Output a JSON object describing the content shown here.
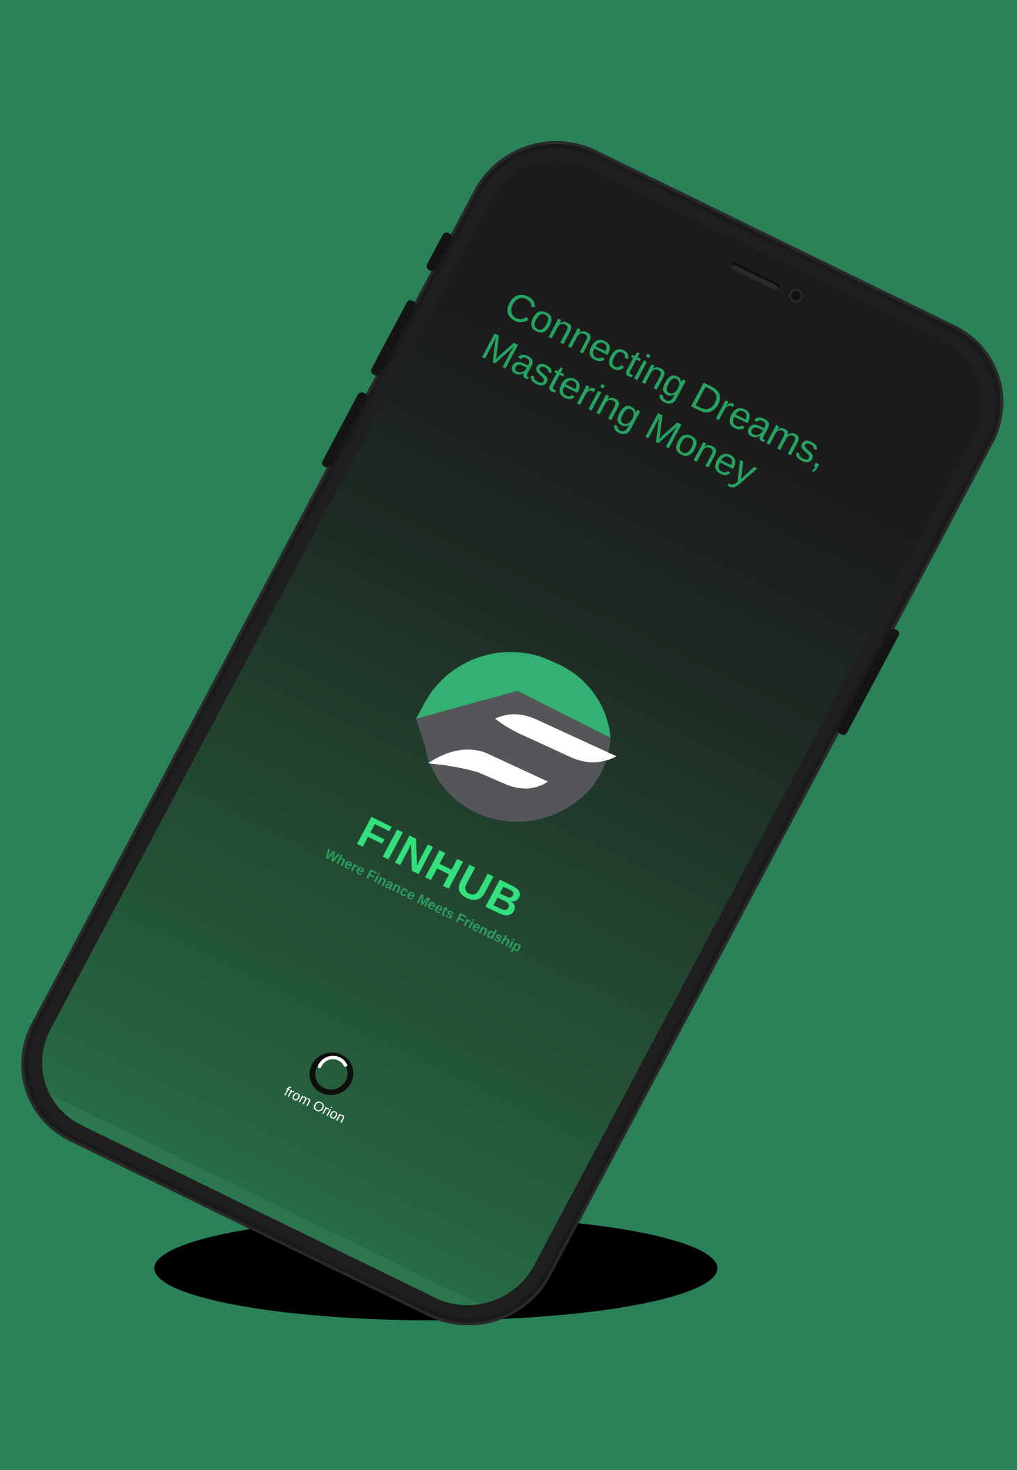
{
  "tagline": {
    "line1": "Connecting Dreams,",
    "line2": "Mastering Money"
  },
  "brand": {
    "name": "FINHUB",
    "subtitle": "Where Finance Meets Friendship"
  },
  "footer": {
    "label": "from Orion"
  },
  "colors": {
    "background": "#2c8258",
    "phone_body": "#1f1f1f",
    "tagline": "#27a361",
    "brand_name": "#33e07d",
    "brand_subtitle": "#2d9d5c",
    "logo_green": "#33b072",
    "logo_gray": "#555659",
    "logo_white": "#ffffff"
  },
  "icons": {
    "finhub_logo": "finhub-logo-icon",
    "orion_logo": "orion-logo-icon",
    "camera": "front-camera-icon",
    "speaker": "earpiece-icon"
  }
}
